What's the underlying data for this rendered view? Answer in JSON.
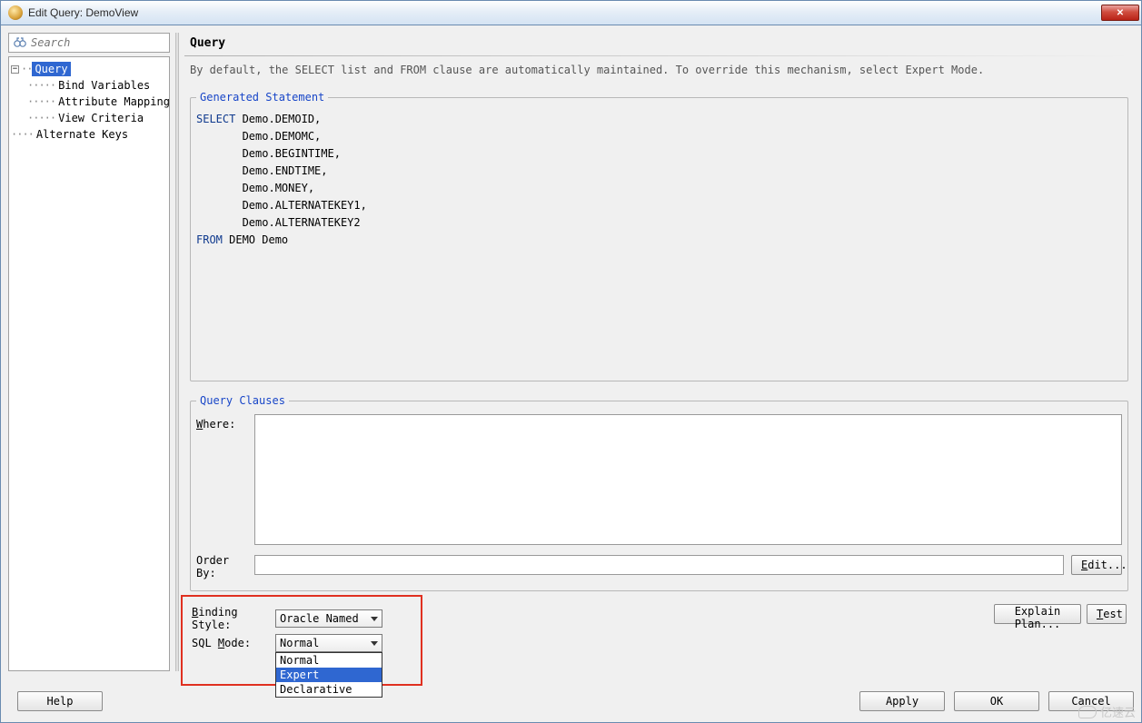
{
  "window": {
    "title": "Edit Query: DemoView"
  },
  "search": {
    "placeholder": "Search"
  },
  "tree": {
    "root": {
      "label": "Query"
    },
    "children": [
      {
        "label": "Bind Variables"
      },
      {
        "label": "Attribute Mappings"
      },
      {
        "label": "View Criteria"
      }
    ],
    "sibling": {
      "label": "Alternate Keys"
    }
  },
  "page": {
    "title": "Query",
    "desc": "By default, the SELECT list and FROM clause are automatically maintained.  To override this mechanism, select Expert Mode."
  },
  "gen": {
    "legend": "Generated Statement",
    "sql_select": "SELECT",
    "sql_cols": [
      "Demo.DEMOID,",
      "Demo.DEMOMC,",
      "Demo.BEGINTIME,",
      "Demo.ENDTIME,",
      "Demo.MONEY,",
      "Demo.ALTERNATEKEY1,",
      "Demo.ALTERNATEKEY2"
    ],
    "sql_from": "FROM",
    "sql_from_rest": " DEMO Demo"
  },
  "clauses": {
    "legend": "Query Clauses",
    "where_label": "Where:",
    "where_mnemonic": "W",
    "orderby_label": "Order By:",
    "edit_btn": "Edit...",
    "edit_mnemonic": "E"
  },
  "binding": {
    "label": "Binding Style:",
    "mnemonic": "B",
    "value": "Oracle Named"
  },
  "sqlmode": {
    "label": "SQL Mode:",
    "mnemonic": "M",
    "value": "Normal",
    "options": [
      "Normal",
      "Expert",
      "Declarative"
    ],
    "selected_index": 1
  },
  "buttons": {
    "explain": "Explain Plan...",
    "test": "Test",
    "test_mnemonic": "T",
    "help": "Help",
    "apply": "Apply",
    "ok": "OK",
    "cancel": "Cancel"
  },
  "watermark": "亿速云"
}
